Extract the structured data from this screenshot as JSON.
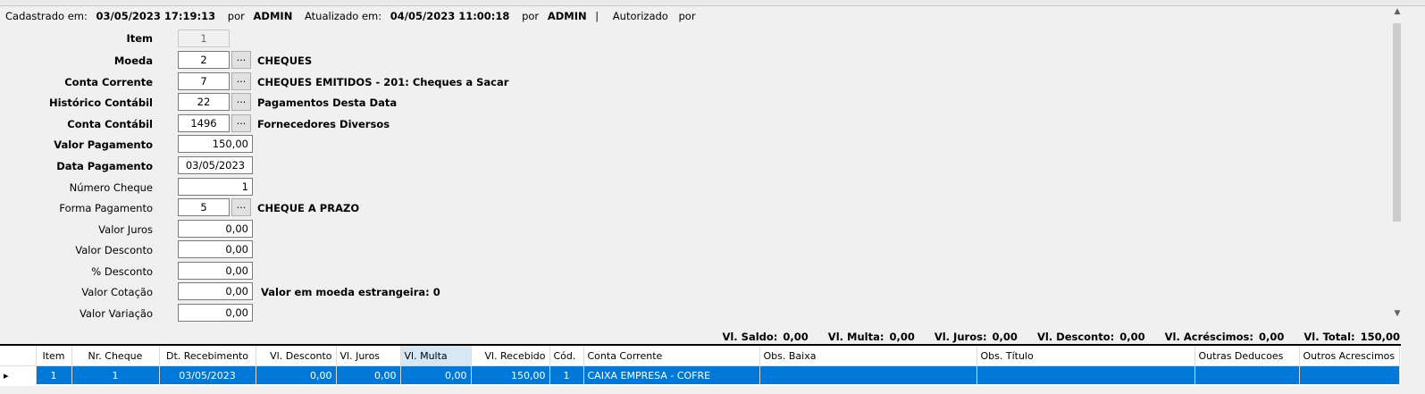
{
  "meta": {
    "created_label": "Cadastrado em:",
    "created_value": "03/05/2023 17:19:13",
    "por1": "por",
    "created_by": "ADMIN",
    "updated_label": "Atualizado em:",
    "updated_value": "04/05/2023 11:00:18",
    "por2": "por",
    "updated_by": "ADMIN",
    "sep": "|",
    "authorized_label": "Autorizado",
    "por3": "por"
  },
  "form": {
    "item": {
      "label": "Item",
      "value": "1"
    },
    "moeda": {
      "label": "Moeda",
      "value": "2",
      "desc": "CHEQUES"
    },
    "conta_corrente": {
      "label": "Conta Corrente",
      "value": "7",
      "desc": "CHEQUES EMITIDOS - 201: Cheques a Sacar"
    },
    "historico": {
      "label": "Histórico Contábil",
      "value": "22",
      "desc": "Pagamentos Desta Data"
    },
    "conta_contabil": {
      "label": "Conta Contábil",
      "value": "1496",
      "desc": "Fornecedores Diversos"
    },
    "valor_pagamento": {
      "label": "Valor Pagamento",
      "value": "150,00"
    },
    "data_pagamento": {
      "label": "Data Pagamento",
      "value": "03/05/2023"
    },
    "numero_cheque": {
      "label": "Número Cheque",
      "value": "1"
    },
    "forma_pagamento": {
      "label": "Forma Pagamento",
      "value": "5",
      "desc": "CHEQUE A PRAZO"
    },
    "valor_juros": {
      "label": "Valor Juros",
      "value": "0,00"
    },
    "valor_desconto": {
      "label": "Valor Desconto",
      "value": "0,00"
    },
    "pct_desconto": {
      "label": "% Desconto",
      "value": "0,00"
    },
    "valor_cotacao": {
      "label": "Valor Cotação",
      "value": "0,00",
      "desc": "Valor em moeda estrangeira: 0"
    },
    "valor_variacao": {
      "label": "Valor Variação",
      "value": "0,00"
    },
    "ellipsis": "..."
  },
  "totals": [
    {
      "label": "Vl. Saldo:",
      "value": "0,00"
    },
    {
      "label": "Vl. Multa:",
      "value": "0,00"
    },
    {
      "label": "Vl. Juros:",
      "value": "0,00"
    },
    {
      "label": "Vl. Desconto:",
      "value": "0,00"
    },
    {
      "label": "Vl. Acréscimos:",
      "value": "0,00"
    },
    {
      "label": "Vl. Total:",
      "value": "150,00"
    }
  ],
  "grid": {
    "columns": [
      "Item",
      "Nr. Cheque",
      "Dt. Recebimento",
      "Vl. Desconto",
      "Vl. Juros",
      "Vl. Multa",
      "Vl. Recebido",
      "Cód.",
      "Conta Corrente",
      "Obs. Baixa",
      "Obs. Título",
      "Outras Deducoes",
      "Outros Acrescimos"
    ],
    "row_indicator": "▸",
    "rows": [
      [
        "1",
        "1",
        "03/05/2023",
        "0,00",
        "0,00",
        "0,00",
        "150,00",
        "1",
        "CAIXA EMPRESA - COFRE",
        "",
        "",
        "",
        ""
      ]
    ]
  },
  "icons": {
    "scroll_up": "scroll-up-arrow",
    "scroll_down": "scroll-down-arrow",
    "row_indicator": "row-pointer"
  }
}
